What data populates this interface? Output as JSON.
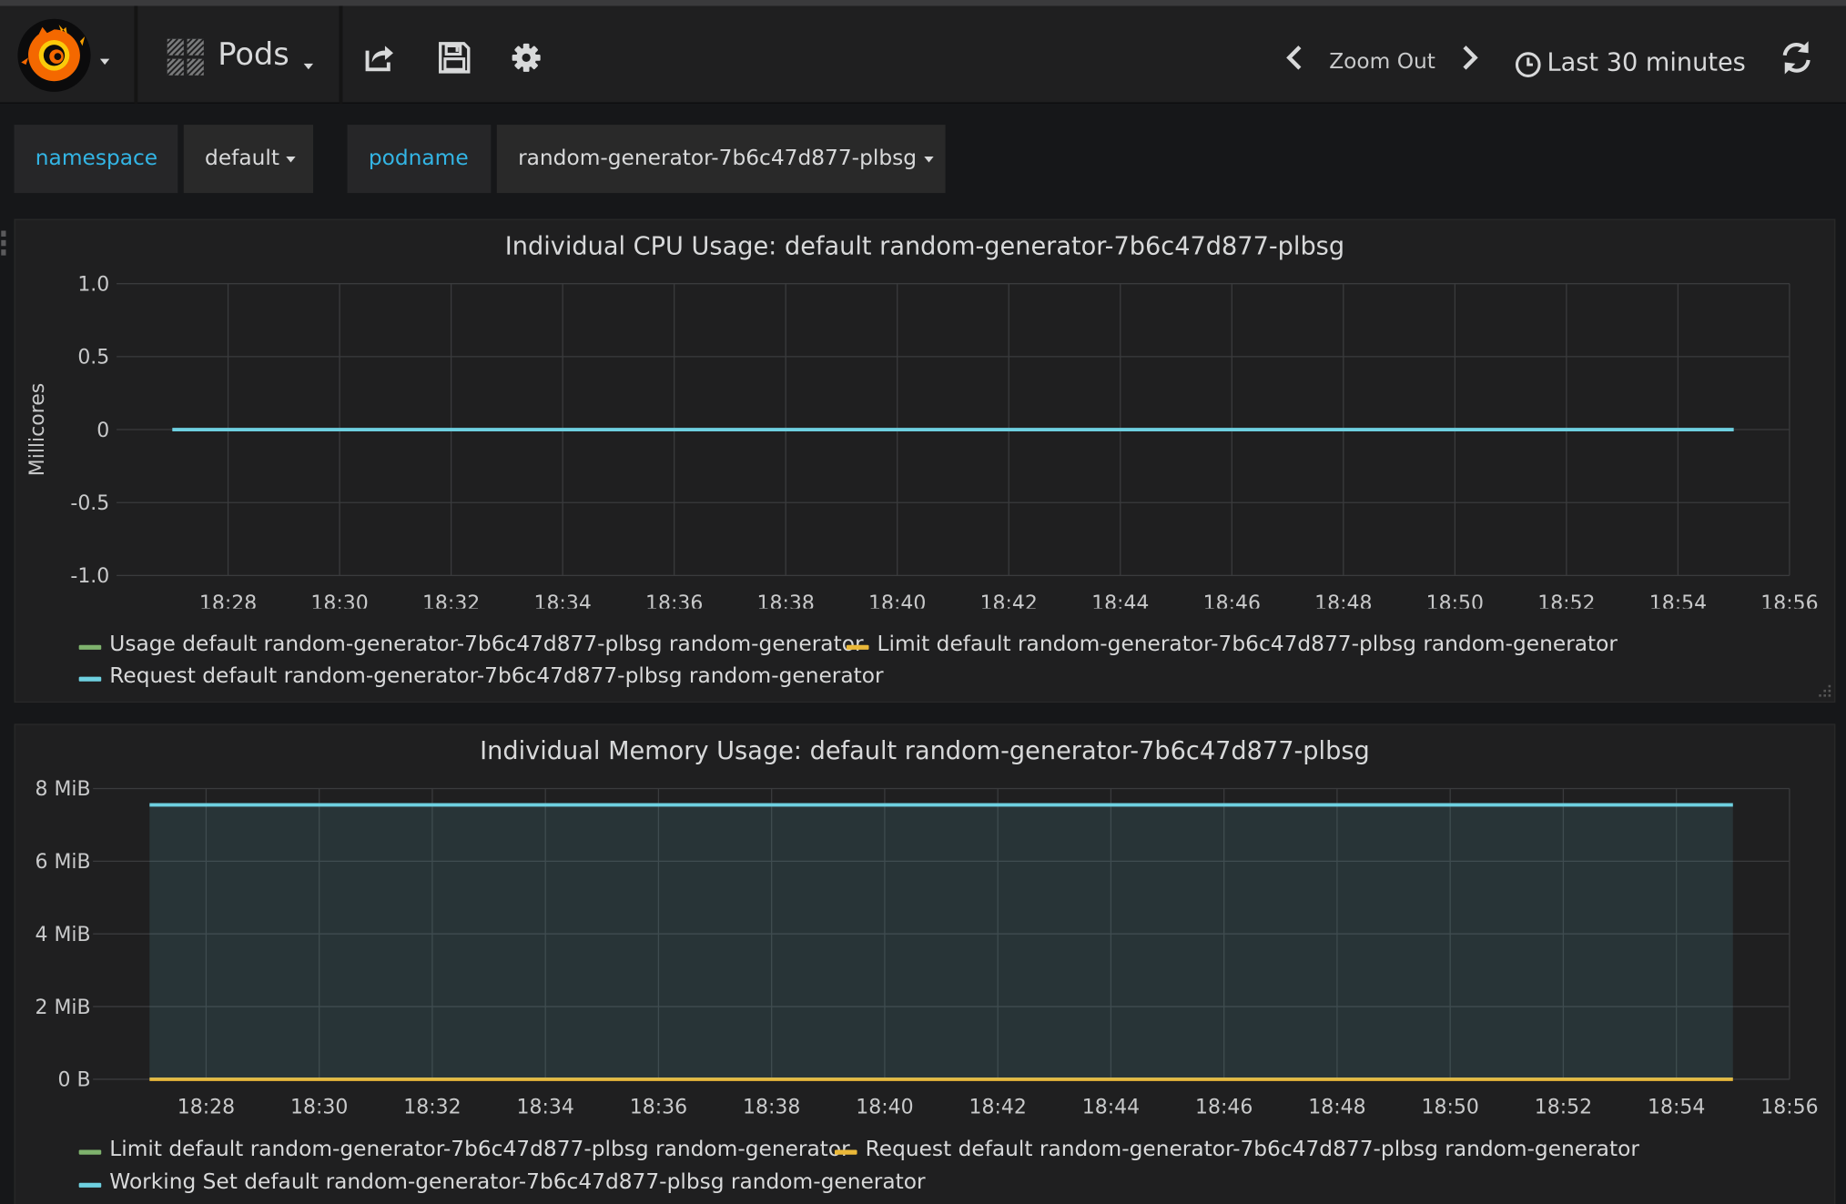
{
  "navbar": {
    "dashboard_title": "Pods",
    "zoom_out_label": "Zoom Out",
    "time_range_label": "Last 30 minutes",
    "icons": [
      "grafana-logo-icon",
      "dashboard-grid-icon",
      "share-icon",
      "save-icon",
      "settings-icon",
      "chevron-left-icon",
      "chevron-right-icon",
      "clock-icon",
      "refresh-icon"
    ]
  },
  "variables": [
    {
      "label": "namespace",
      "value": "default"
    },
    {
      "label": "podname",
      "value": "random-generator-7b6c47d877-plbsg"
    }
  ],
  "colors": {
    "accent": "#33b5e5",
    "green": "#7eb26d",
    "yellow": "#eab839",
    "blue": "#6ed0e0",
    "background": "#161719",
    "panel": "#1f1f20"
  },
  "panels": [
    {
      "title": "Individual CPU Usage: default random-generator-7b6c47d877-plbsg",
      "legend": [
        {
          "name": "Usage default random-generator-7b6c47d877-plbsg random-generator",
          "color": "#7eb26d"
        },
        {
          "name": "Limit default random-generator-7b6c47d877-plbsg random-generator",
          "color": "#eab839"
        },
        {
          "name": "Request default random-generator-7b6c47d877-plbsg random-generator",
          "color": "#6ed0e0"
        }
      ]
    },
    {
      "title": "Individual Memory Usage: default random-generator-7b6c47d877-plbsg",
      "legend": [
        {
          "name": "Limit default random-generator-7b6c47d877-plbsg random-generator",
          "color": "#7eb26d"
        },
        {
          "name": "Request default random-generator-7b6c47d877-plbsg random-generator",
          "color": "#eab839"
        },
        {
          "name": "Working Set default random-generator-7b6c47d877-plbsg random-generator",
          "color": "#6ed0e0"
        }
      ]
    }
  ],
  "chart_data": [
    {
      "type": "line",
      "title": "Individual CPU Usage: default random-generator-7b6c47d877-plbsg",
      "ylabel": "Millicores",
      "xlabel": "",
      "x_ticks": [
        "18:28",
        "18:30",
        "18:32",
        "18:34",
        "18:36",
        "18:38",
        "18:40",
        "18:42",
        "18:44",
        "18:46",
        "18:48",
        "18:50",
        "18:52",
        "18:54",
        "18:56"
      ],
      "y_ticks": [
        "1.0",
        "0.5",
        "0",
        "-0.5",
        "-1.0"
      ],
      "ylim": [
        -1.0,
        1.0
      ],
      "xlim": [
        "18:26:00",
        "18:56:00"
      ],
      "grid": true,
      "legend_position": "bottom",
      "series": [
        {
          "name": "Usage default random-generator-7b6c47d877-plbsg random-generator",
          "color": "#7eb26d",
          "x": [],
          "values": []
        },
        {
          "name": "Limit default random-generator-7b6c47d877-plbsg random-generator",
          "color": "#eab839",
          "x": [],
          "values": []
        },
        {
          "name": "Request default random-generator-7b6c47d877-plbsg random-generator",
          "color": "#6ed0e0",
          "x": [
            "18:27:00",
            "18:55:00"
          ],
          "values": [
            0,
            0
          ]
        }
      ]
    },
    {
      "type": "area",
      "title": "Individual Memory Usage: default random-generator-7b6c47d877-plbsg",
      "ylabel": "",
      "xlabel": "",
      "x_ticks": [
        "18:28",
        "18:30",
        "18:32",
        "18:34",
        "18:36",
        "18:38",
        "18:40",
        "18:42",
        "18:44",
        "18:46",
        "18:48",
        "18:50",
        "18:52",
        "18:54",
        "18:56"
      ],
      "y_ticks": [
        "8 MiB",
        "6 MiB",
        "4 MiB",
        "2 MiB",
        "0 B"
      ],
      "ylim": [
        0,
        8
      ],
      "y_unit": "MiB",
      "xlim": [
        "18:26:00",
        "18:56:00"
      ],
      "grid": true,
      "legend_position": "bottom",
      "series": [
        {
          "name": "Limit default random-generator-7b6c47d877-plbsg random-generator",
          "color": "#7eb26d",
          "x": [],
          "values": []
        },
        {
          "name": "Request default random-generator-7b6c47d877-plbsg random-generator",
          "color": "#eab839",
          "x": [
            "18:27:00",
            "18:55:00"
          ],
          "values": [
            0,
            0
          ]
        },
        {
          "name": "Working Set default random-generator-7b6c47d877-plbsg random-generator",
          "color": "#6ed0e0",
          "x": [
            "18:27:00",
            "18:55:00"
          ],
          "values": [
            7.55,
            7.55
          ],
          "fill": true
        }
      ]
    }
  ]
}
